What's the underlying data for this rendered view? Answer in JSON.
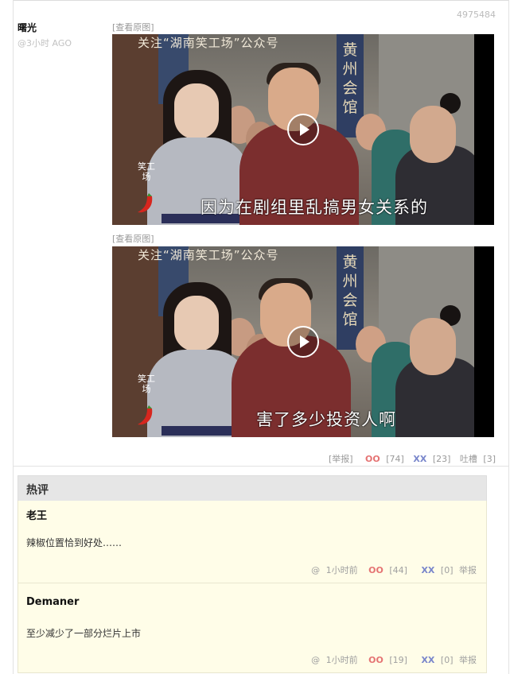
{
  "post": {
    "id": "4975484",
    "author": "曙光",
    "time": "@3小时 AGO",
    "view_original": "[查看原图]",
    "media": [
      {
        "top_caption": "关注“湖南笑工场”公众号",
        "bottom_caption": "因为在剧组里乱搞男女关系的",
        "sign_text": "黄州会馆",
        "logo_text": "笑工场"
      },
      {
        "top_caption": "关注“湖南笑工场”公众号",
        "bottom_caption": "害了多少投资人啊",
        "sign_text": "黄州会馆",
        "logo_text": "笑工场"
      }
    ],
    "actions": {
      "report": "[举报]",
      "oo_label": "OO",
      "oo_count": "[74]",
      "xx_label": "XX",
      "xx_count": "[23]",
      "tucao_label": "吐槽",
      "tucao_count": "[3]"
    }
  },
  "hot_comments": {
    "title": "热评",
    "items": [
      {
        "author": "老王",
        "text": "辣椒位置恰到好处……",
        "at": "@",
        "time": "1小时前",
        "oo_label": "OO",
        "oo_count": "[44]",
        "xx_label": "XX",
        "xx_count": "[0]",
        "report": "举报"
      },
      {
        "author": "Demaner",
        "text": "至少减少了一部分烂片上市",
        "at": "@",
        "time": "1小时前",
        "oo_label": "OO",
        "oo_count": "[19]",
        "xx_label": "XX",
        "xx_count": "[0]",
        "report": "举报"
      }
    ]
  },
  "colors": {
    "oo": "#e57373",
    "xx": "#7986cb",
    "comment_bg": "#fffde8",
    "hot_header_bg": "#e6e6e6"
  },
  "icons": [
    "play-icon",
    "chili-logo-icon"
  ]
}
